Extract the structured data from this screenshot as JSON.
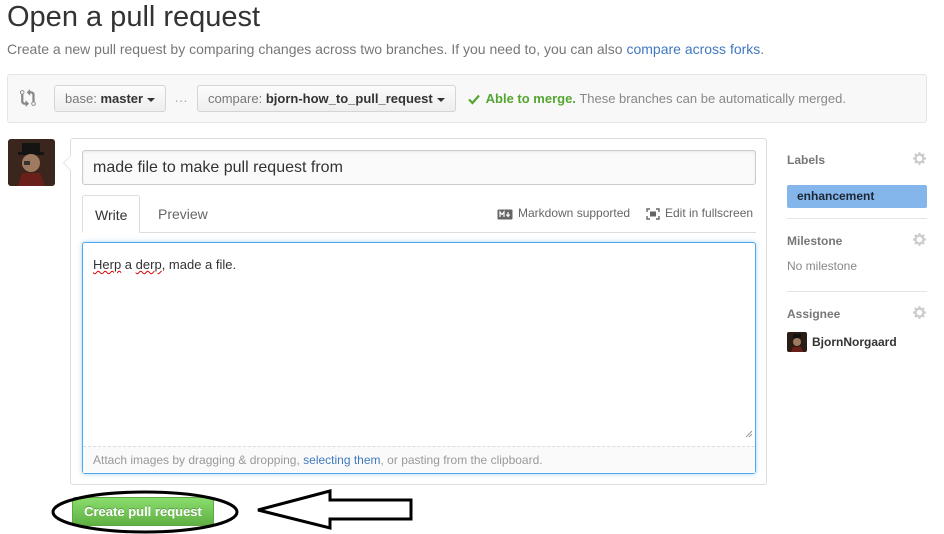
{
  "header": {
    "title": "Open a pull request",
    "subtitle_prefix": "Create a new pull request by comparing changes across two branches. If you need to, you can also ",
    "subtitle_link": "compare across forks",
    "subtitle_suffix": "."
  },
  "compare": {
    "base_prefix": "base:",
    "base_branch": "master",
    "ellipsis": "…",
    "compare_prefix": "compare:",
    "compare_branch": "bjorn-how_to_pull_request",
    "merge_ok": "Able to merge.",
    "merge_detail": "These branches can be automatically merged."
  },
  "form": {
    "title_value": "made file to make pull request from",
    "tabs": [
      {
        "label": "Write"
      },
      {
        "label": "Preview"
      }
    ],
    "markdown_label": "Markdown supported",
    "fullscreen_label": "Edit in fullscreen",
    "body_word1": "Herp",
    "body_mid": " a ",
    "body_word2": "derp",
    "body_rest": ", made a file.",
    "drop_prefix": "Attach images by dragging & dropping, ",
    "drop_link": "selecting them",
    "drop_suffix": ", or pasting from the clipboard."
  },
  "sidebar": {
    "labels_heading": "Labels",
    "label_name": "enhancement",
    "label_color": "#84b6eb",
    "milestone_heading": "Milestone",
    "milestone_value": "No milestone",
    "assignee_heading": "Assignee",
    "assignee_name": "BjornNorgaard"
  },
  "actions": {
    "create_label": "Create pull request"
  },
  "colors": {
    "link": "#4078c0",
    "success": "#55a532",
    "button_green": "#60b044",
    "focus_blue": "#51a7e8"
  }
}
